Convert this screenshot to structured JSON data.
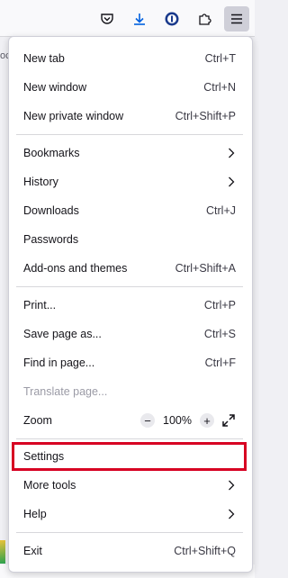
{
  "toolbar": {
    "icons": [
      "pocket-icon",
      "download-icon",
      "password-manager-icon",
      "extensions-icon",
      "hamburger-menu-icon"
    ],
    "bookmark_edge": "oc"
  },
  "menu": {
    "new_tab": {
      "label": "New tab",
      "shortcut": "Ctrl+T"
    },
    "new_window": {
      "label": "New window",
      "shortcut": "Ctrl+N"
    },
    "new_private_window": {
      "label": "New private window",
      "shortcut": "Ctrl+Shift+P"
    },
    "bookmarks": {
      "label": "Bookmarks"
    },
    "history": {
      "label": "History"
    },
    "downloads": {
      "label": "Downloads",
      "shortcut": "Ctrl+J"
    },
    "passwords": {
      "label": "Passwords"
    },
    "addons": {
      "label": "Add-ons and themes",
      "shortcut": "Ctrl+Shift+A"
    },
    "print": {
      "label": "Print...",
      "shortcut": "Ctrl+P"
    },
    "save_page": {
      "label": "Save page as...",
      "shortcut": "Ctrl+S"
    },
    "find": {
      "label": "Find in page...",
      "shortcut": "Ctrl+F"
    },
    "translate": {
      "label": "Translate page..."
    },
    "zoom": {
      "label": "Zoom",
      "minus": "−",
      "value": "100%",
      "plus": "+"
    },
    "settings": {
      "label": "Settings"
    },
    "more_tools": {
      "label": "More tools"
    },
    "help": {
      "label": "Help"
    },
    "exit": {
      "label": "Exit",
      "shortcut": "Ctrl+Shift+Q"
    }
  },
  "colors": {
    "highlight": "#d70022",
    "menu_bg": "#ffffff",
    "toolbar_bg": "#f9f9fb"
  }
}
